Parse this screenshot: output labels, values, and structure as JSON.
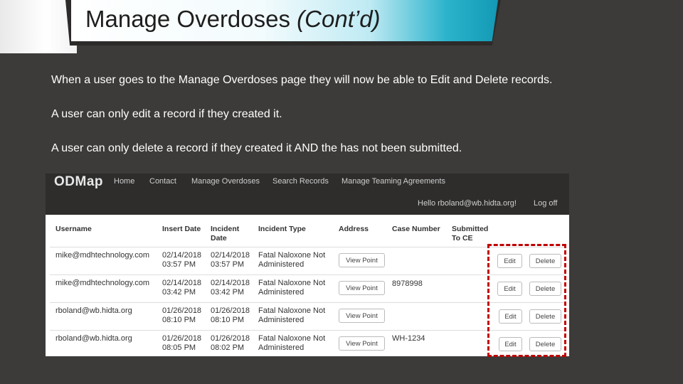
{
  "slide": {
    "title_main": "Manage Overdoses ",
    "title_italic": "(Cont’d)",
    "paragraphs": [
      "When a user goes to the Manage Overdoses page they will now be able to Edit and Delete records.",
      "A user can only edit a record if they created it.",
      "A user can only delete a record if they created it AND the  has not been submitted."
    ]
  },
  "app": {
    "brand": "ODMap",
    "nav": [
      "Home",
      "Contact",
      "Manage Overdoses",
      "Search Records",
      "Manage Teaming Agreements"
    ],
    "greeting": "Hello rboland@wb.hidta.org!",
    "logoff": "Log off"
  },
  "table": {
    "headers": {
      "username": "Username",
      "insert_date": "Insert Date",
      "incident_date_1": "Incident",
      "incident_date_2": "Date",
      "incident_type": "Incident Type",
      "address": "Address",
      "case_number": "Case Number",
      "submitted_1": "Submitted",
      "submitted_2": "To CE"
    },
    "view_label": "View Point",
    "edit_label": "Edit",
    "delete_label": "Delete",
    "rows": [
      {
        "username": "mike@mdhtechnology.com",
        "insert_date": "02/14/2018",
        "insert_time": "03:57 PM",
        "incident_date": "02/14/2018",
        "incident_time": "03:57 PM",
        "type_1": "Fatal Naloxone Not",
        "type_2": "Administered",
        "case": ""
      },
      {
        "username": "mike@mdhtechnology.com",
        "insert_date": "02/14/2018",
        "insert_time": "03:42 PM",
        "incident_date": "02/14/2018",
        "incident_time": "03:42 PM",
        "type_1": "Fatal Naloxone Not",
        "type_2": "Administered",
        "case": "8978998"
      },
      {
        "username": "rboland@wb.hidta.org",
        "insert_date": "01/26/2018",
        "insert_time": "08:10 PM",
        "incident_date": "01/26/2018",
        "incident_time": "08:10 PM",
        "type_1": "Fatal Naloxone Not",
        "type_2": "Administered",
        "case": ""
      },
      {
        "username": "rboland@wb.hidta.org",
        "insert_date": "01/26/2018",
        "insert_time": "08:05 PM",
        "incident_date": "01/26/2018",
        "incident_time": "08:02 PM",
        "type_1": "Fatal Naloxone Not",
        "type_2": "Administered",
        "case": "WH-1234"
      }
    ]
  },
  "colors": {
    "slide_background": "#3d3b39",
    "banner_accent": "#1399b4",
    "highlight_border": "#c00000",
    "navbar": "#2e2d2c"
  }
}
